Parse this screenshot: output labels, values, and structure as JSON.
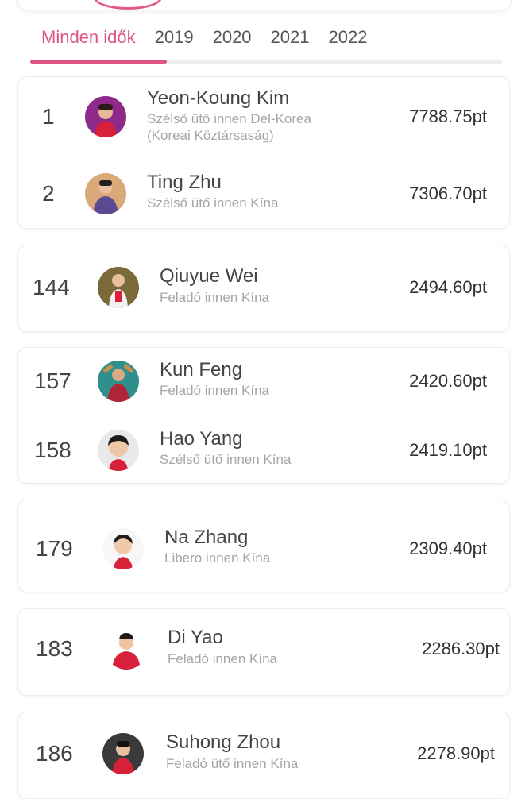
{
  "tabs": [
    {
      "label": "Minden idők",
      "active": true
    },
    {
      "label": "2019",
      "active": false
    },
    {
      "label": "2020",
      "active": false
    },
    {
      "label": "2021",
      "active": false
    },
    {
      "label": "2022",
      "active": false
    }
  ],
  "accent_color": "#e05485",
  "players": [
    {
      "rank": "1",
      "name": "Yeon-Koung Kim",
      "subtitle": "Szélső ütő innen Dél-Korea",
      "subtitle2": "(Koreai Köztársaság)",
      "points": "7788.75pt",
      "avatar": "player-photo"
    },
    {
      "rank": "2",
      "name": "Ting Zhu",
      "subtitle": "Szélső ütő innen Kína",
      "points": "7306.70pt",
      "avatar": "player-photo"
    },
    {
      "rank": "144",
      "name": "Qiuyue Wei",
      "subtitle": "Feladó innen Kína",
      "points": "2494.60pt",
      "avatar": "player-photo"
    },
    {
      "rank": "157",
      "name": "Kun Feng",
      "subtitle": "Feladó innen Kína",
      "points": "2420.60pt",
      "avatar": "player-photo"
    },
    {
      "rank": "158",
      "name": "Hao Yang",
      "subtitle": "Szélső ütő innen Kína",
      "points": "2419.10pt",
      "avatar": "player-photo"
    },
    {
      "rank": "179",
      "name": "Na Zhang",
      "subtitle": "Libero innen Kína",
      "points": "2309.40pt",
      "avatar": "player-photo"
    },
    {
      "rank": "183",
      "name": "Di Yao",
      "subtitle": "Feladó innen Kína",
      "points": "2286.30pt",
      "avatar": "player-photo"
    },
    {
      "rank": "186",
      "name": "Suhong Zhou",
      "subtitle": "Feladó ütő innen Kína",
      "points": "2278.90pt",
      "avatar": "player-photo"
    }
  ]
}
